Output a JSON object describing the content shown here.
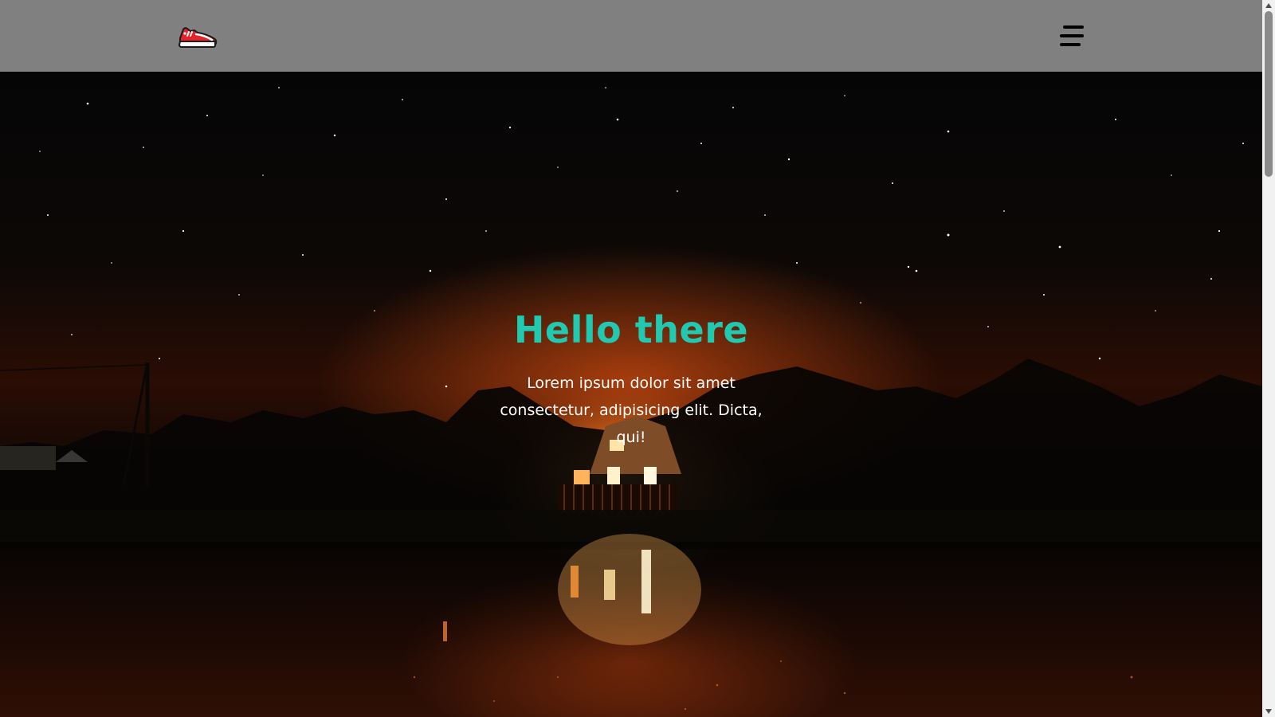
{
  "header": {
    "logo_icon": "sneaker-icon",
    "menu_icon": "hamburger-menu-icon"
  },
  "hero": {
    "title": "Hello there",
    "text": "Lorem ipsum dolor sit amet consectetur, adipisicing elit. Dicta, qui!",
    "background": "night-sky-lake-house-photo"
  },
  "colors": {
    "navbar": "#808080",
    "title": "#20c9b0",
    "text": "#ffffff"
  }
}
